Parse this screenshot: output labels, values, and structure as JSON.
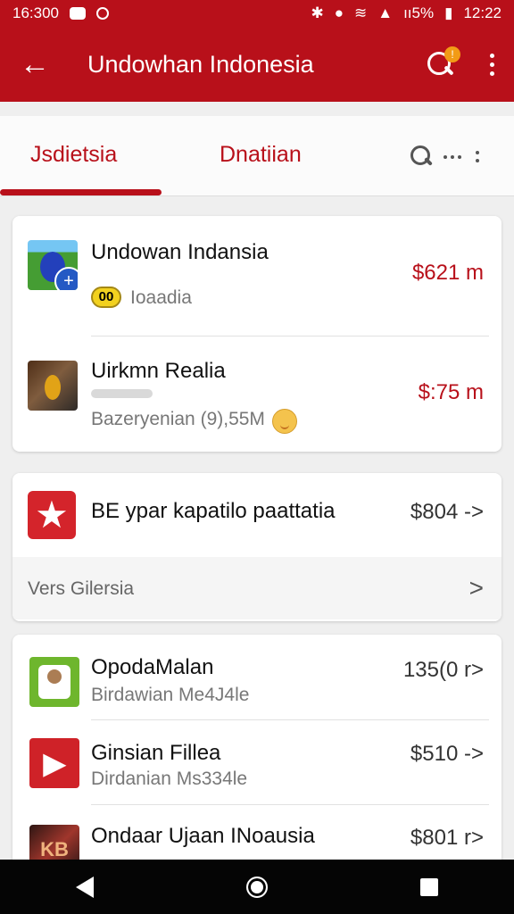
{
  "status_bar": {
    "time_left": "16:300",
    "time_right": "12:22",
    "battery": "ıı5%"
  },
  "app_bar": {
    "title": "Undowhan Indonesia",
    "back_icon": "back-arrow-icon",
    "search_icon": "search-icon",
    "notification": "!",
    "more_icon": "more-vert-icon"
  },
  "tabs": [
    "Jsdietsia",
    "Dnatiian"
  ],
  "primary_card": {
    "items": [
      {
        "title": "Undowan Indansia",
        "badge": "00",
        "subtitle": "Ioaadia",
        "price": "$621 m"
      },
      {
        "title": "Uirkmn Realia",
        "subtitle": "Bazeryenian (9),55M",
        "price": "$:75 m"
      }
    ]
  },
  "offer_card": {
    "title": "BE ypar kapatilo paattatia",
    "price": "$804 ->",
    "footer": "Vers Gilersia",
    "chevron": ">"
  },
  "list_card": {
    "items": [
      {
        "title": "OpodaMalan",
        "subtitle": "Birdawian Me4J4le",
        "price": "135(0 r>"
      },
      {
        "title": "Ginsian Fillea",
        "subtitle": "Dirdanian Ms334le",
        "price": "$510 ->"
      },
      {
        "title": "Ondaar Ujaan INoausia",
        "subtitle": "",
        "price": "$801 r>"
      }
    ]
  }
}
